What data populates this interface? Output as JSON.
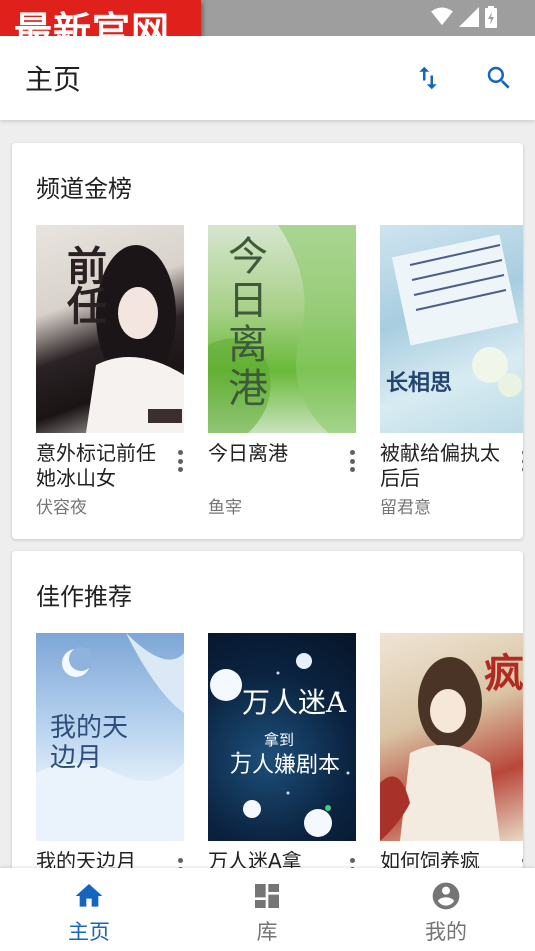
{
  "badge": {
    "text": "最新官网"
  },
  "app_bar": {
    "title": "主页",
    "sort_icon": "swap-vertical-icon",
    "search_icon": "search-icon"
  },
  "sections": [
    {
      "title": "频道金榜",
      "books": [
        {
          "title": "意外标记前任她冰山女",
          "author": "伏容夜",
          "cover_text": "前任"
        },
        {
          "title": "今日离港",
          "author": "鱼宰",
          "cover_text": "今日离港"
        },
        {
          "title": "被献给偏执太后后",
          "author": "留君意",
          "cover_text": "长相思"
        }
      ]
    },
    {
      "title": "佳作推荐",
      "books": [
        {
          "title": "我的天边月",
          "cover_text": "我的天边月"
        },
        {
          "title": "万人迷A拿",
          "cover_text": "万人迷A",
          "cover_sub1": "拿到",
          "cover_sub2": "万人嫌剧本"
        },
        {
          "title": "如何饲养疯",
          "cover_text": "疯"
        }
      ]
    }
  ],
  "bottom_nav": [
    {
      "label": "主页",
      "icon": "home-icon",
      "active": true
    },
    {
      "label": "库",
      "icon": "library-grid-icon",
      "active": false
    },
    {
      "label": "我的",
      "icon": "account-circle-icon",
      "active": false
    }
  ],
  "colors": {
    "accent": "#1565c0",
    "badge": "#e0201a",
    "inactive": "#757575"
  }
}
